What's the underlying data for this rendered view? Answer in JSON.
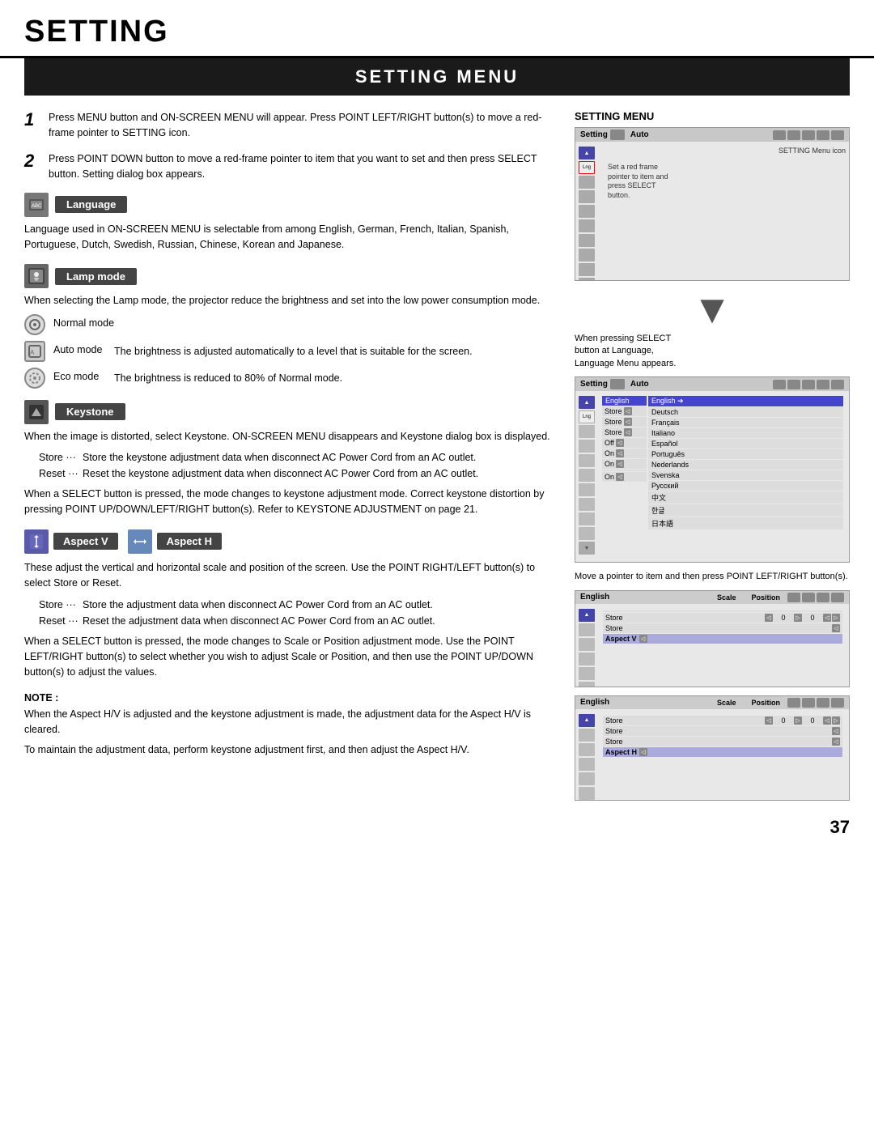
{
  "header": {
    "title": "SETTING"
  },
  "section": {
    "title": "SETTING MENU"
  },
  "steps": [
    {
      "num": "1",
      "text": "Press MENU button and ON-SCREEN MENU will appear.  Press POINT LEFT/RIGHT button(s) to move a red-frame pointer to SETTING icon."
    },
    {
      "num": "2",
      "text": "Press POINT DOWN button to move a red-frame pointer to item that you want to set and then press SELECT button.  Setting dialog box appears."
    }
  ],
  "features": {
    "language": {
      "title": "Language",
      "desc": "Language used in ON-SCREEN MENU is selectable from among English, German, French, Italian, Spanish, Portuguese, Dutch, Swedish, Russian, Chinese, Korean and Japanese."
    },
    "lamp_mode": {
      "title": "Lamp mode",
      "desc": "When selecting the Lamp mode, the projector reduce the brightness and set into the low power consumption mode.",
      "modes": [
        {
          "label": "Normal mode",
          "desc": ""
        },
        {
          "label": "Auto mode",
          "desc": "The brightness is adjusted automatically to a level that is suitable for the screen."
        },
        {
          "label": "Eco mode",
          "desc": "The brightness is reduced to 80% of Normal mode."
        }
      ]
    },
    "keystone": {
      "title": "Keystone",
      "desc": "When the image is distorted, select Keystone.  ON-SCREEN MENU disappears and Keystone dialog box is displayed.",
      "store_text": "Store ···  Store the keystone adjustment data when disconnect AC Power Cord from an AC outlet.",
      "reset_text": "Reset ···  Reset the keystone adjustment data when disconnect AC Power Cord from an AC outlet.",
      "extra": "When a SELECT button is pressed, the mode changes to keystone adjustment mode. Correct keystone distortion by pressing POINT UP/DOWN/LEFT/RIGHT  button(s).  Refer to  KEYSTONE ADJUSTMENT on page 21."
    },
    "aspect": {
      "btn_v": "Aspect V",
      "btn_h": "Aspect H",
      "desc": "These adjust the vertical and horizontal scale and position of the screen. Use the POINT RIGHT/LEFT button(s) to select Store or Reset.",
      "store": "Store ···  Store the adjustment data when disconnect AC Power Cord from an AC outlet.",
      "reset": "Reset ···  Reset the adjustment data when disconnect AC Power Cord from an AC outlet.",
      "extra": "When a SELECT button is pressed, the mode changes to Scale or Position adjustment mode. Use the POINT LEFT/RIGHT button(s) to select whether you wish to adjust Scale or Position, and then use the POINT UP/DOWN button(s) to adjust the values."
    }
  },
  "note": {
    "title": "NOTE :",
    "text1": "When the Aspect H/V is adjusted and the keystone adjustment is made, the adjustment data for the Aspect H/V is cleared.",
    "text2": "To maintain the adjustment data, perform keystone adjustment first, and then adjust the Aspect H/V."
  },
  "right_panel": {
    "setting_menu_label": "SETTING MENU",
    "setting_menu_icon_caption": "SETTING Menu icon",
    "callout1": "Set a red frame pointer to item and press SELECT button.",
    "callout2": "When pressing SELECT button at Language, Language Menu appears.",
    "caption3": "Move a pointer to item and then press POINT LEFT/RIGHT button(s).",
    "caption4": "",
    "lang_list": [
      "English",
      "Deutsch",
      "Français",
      "Italiano",
      "Español",
      "Português",
      "Nederlands",
      "Svenska",
      "Русский",
      "中文",
      "한글",
      "日本語"
    ],
    "selected_lang": "English",
    "panel1_toolbar": {
      "left": "Setting",
      "right": "Auto"
    },
    "panel2_toolbar": {
      "left": "Setting",
      "right": "Auto"
    },
    "panel3_toolbar": {
      "left": "English",
      "scale": "Scale",
      "position": "Position"
    },
    "panel4_toolbar": {
      "left": "English",
      "scale": "Scale",
      "position": "Position"
    },
    "aspect_v_rows": [
      "Store",
      "Store",
      "Aspect V"
    ],
    "aspect_h_rows": [
      "Store",
      "Store",
      "Store",
      "Aspect H"
    ],
    "scale_val": "0",
    "position_val": "0"
  },
  "page_number": "37"
}
